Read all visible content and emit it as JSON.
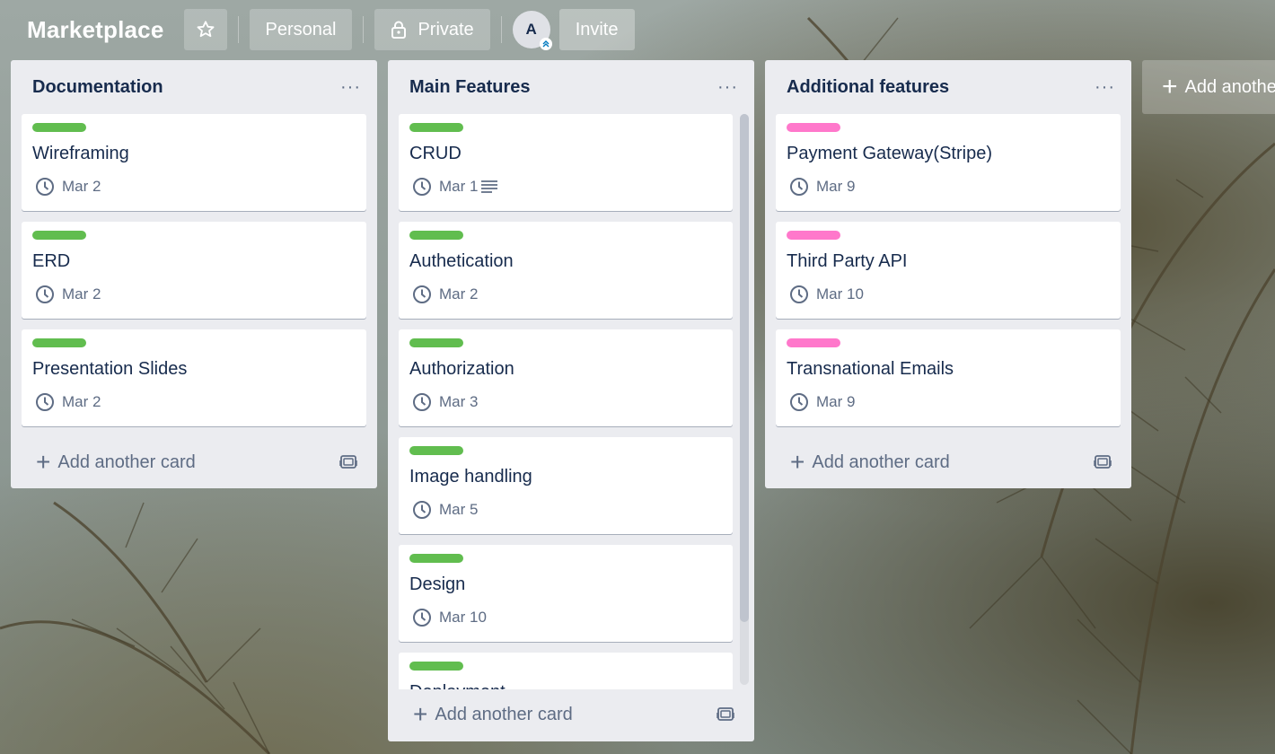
{
  "header": {
    "board_title": "Marketplace",
    "workspace": "Personal",
    "visibility": "Private",
    "avatar_initial": "A",
    "invite": "Invite"
  },
  "lists": [
    {
      "title": "Documentation",
      "cards": [
        {
          "title": "Wireframing",
          "due": "Mar 2",
          "label_color": "#61bd4f"
        },
        {
          "title": "ERD",
          "due": "Mar 2",
          "label_color": "#61bd4f"
        },
        {
          "title": "Presentation Slides",
          "due": "Mar 2",
          "label_color": "#61bd4f"
        }
      ],
      "add_card": "Add another card"
    },
    {
      "title": "Main Features",
      "cards": [
        {
          "title": "CRUD",
          "due": "Mar 1",
          "label_color": "#61bd4f",
          "has_description": true
        },
        {
          "title": "Authetication",
          "due": "Mar 2",
          "label_color": "#61bd4f"
        },
        {
          "title": "Authorization",
          "due": "Mar 3",
          "label_color": "#61bd4f"
        },
        {
          "title": "Image handling",
          "due": "Mar 5",
          "label_color": "#61bd4f"
        },
        {
          "title": "Design",
          "due": "Mar 10",
          "label_color": "#61bd4f"
        },
        {
          "title": "Deployment",
          "due": "",
          "label_color": "#61bd4f"
        }
      ],
      "add_card": "Add another card"
    },
    {
      "title": "Additional features",
      "cards": [
        {
          "title": "Payment Gateway(Stripe)",
          "due": "Mar 9",
          "label_color": "#ff78cb"
        },
        {
          "title": "Third Party API",
          "due": "Mar 10",
          "label_color": "#ff78cb"
        },
        {
          "title": "Transnational Emails",
          "due": "Mar 9",
          "label_color": "#ff78cb"
        }
      ],
      "add_card": "Add another card"
    }
  ],
  "add_list": "Add another list",
  "icons": {
    "star": "star-icon",
    "lock": "lock-icon",
    "clock": "clock-icon",
    "description": "description-icon",
    "template": "card-template-icon",
    "menu": "list-menu-icon",
    "plus": "plus-icon"
  }
}
